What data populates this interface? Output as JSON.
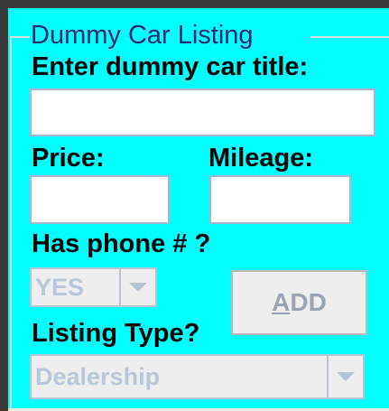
{
  "panel": {
    "title": "Dummy Car Listing"
  },
  "form": {
    "title_label": "Enter dummy car title:",
    "title_value": "",
    "price_label": "Price:",
    "price_value": "",
    "mileage_label": "Mileage:",
    "mileage_value": "",
    "phone_label": "Has phone # ?",
    "phone_selected": "YES",
    "listing_type_label": "Listing Type?",
    "listing_type_selected": "Dealership"
  },
  "add_button": {
    "mnemonic": "A",
    "rest": "DD"
  },
  "icons": {
    "dropdown": "chevron-down-icon"
  },
  "colors": {
    "background": "#00ffff",
    "disabled_text": "#b8c8da",
    "title_text": "#2a2a6a"
  }
}
